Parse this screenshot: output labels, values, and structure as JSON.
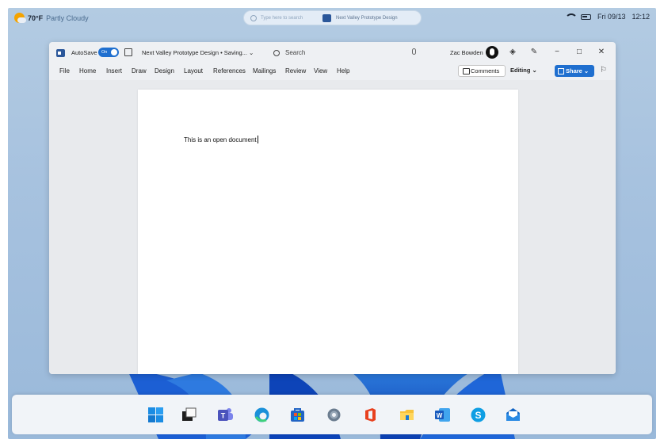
{
  "topbar": {
    "weather_temp": "70°F",
    "weather_condition": "Partly Cloudy",
    "search_placeholder": "Type here to search",
    "active_doc": "Next Valley Prototype Design",
    "date": "Fri 09/13",
    "time": "12:12"
  },
  "window": {
    "autosave_label": "AutoSave",
    "toggle_label": "On",
    "doc_title": "Next Valley Prototype Design • Saving... ⌄",
    "search_label": "Search",
    "user_name": "Zac Bowden",
    "menu": [
      "File",
      "Home",
      "Insert",
      "Draw",
      "Design",
      "Layout",
      "References",
      "Mailings",
      "Review",
      "View",
      "Help"
    ],
    "comments_label": "Comments",
    "editing_label": "Editing ⌄",
    "share_label": "Share ⌄",
    "body_text": "This is an open document"
  },
  "taskbar_apps": [
    "windows-start",
    "task-view",
    "teams",
    "edge",
    "store",
    "settings",
    "office",
    "file-explorer",
    "word",
    "skype",
    "mail"
  ],
  "colors": {
    "accent": "#1f6fcf",
    "word_blue": "#2b579a"
  }
}
